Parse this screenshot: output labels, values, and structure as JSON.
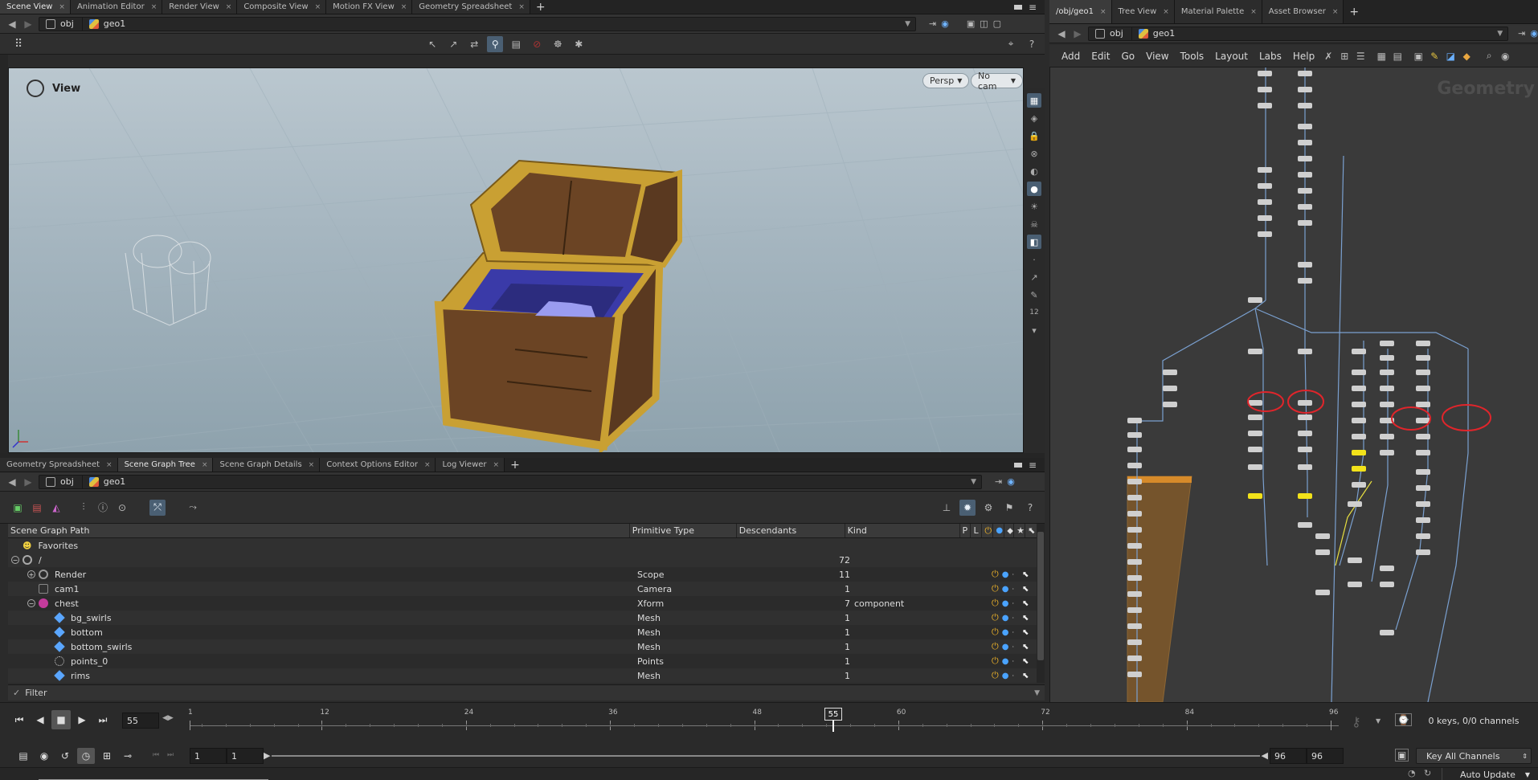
{
  "left_tabs": [
    {
      "label": "Scene View",
      "active": true
    },
    {
      "label": "Animation Editor"
    },
    {
      "label": "Render View"
    },
    {
      "label": "Composite View"
    },
    {
      "label": "Motion FX View"
    },
    {
      "label": "Geometry Spreadsheet"
    }
  ],
  "right_tabs": [
    {
      "label": "/obj/geo1",
      "active": true
    },
    {
      "label": "Tree View"
    },
    {
      "label": "Material Palette"
    },
    {
      "label": "Asset Browser"
    }
  ],
  "path": {
    "root": "obj",
    "node": "geo1"
  },
  "viewport": {
    "title": "View",
    "persp_label": "Persp",
    "cam_label": "No cam"
  },
  "bottom_tabs": [
    {
      "label": "Geometry Spreadsheet"
    },
    {
      "label": "Scene Graph Tree",
      "active": true
    },
    {
      "label": "Scene Graph Details"
    },
    {
      "label": "Context Options Editor"
    },
    {
      "label": "Log Viewer"
    }
  ],
  "scene_graph": {
    "columns": [
      "Scene Graph Path",
      "Primitive Type",
      "Descendants",
      "Kind",
      "P",
      "L"
    ],
    "favorites_label": "Favorites",
    "rows": [
      {
        "name": "/",
        "type": "",
        "desc": "72",
        "kind": "",
        "depth": 0,
        "icon": "root"
      },
      {
        "name": "Render",
        "type": "Scope",
        "desc": "11",
        "kind": "",
        "depth": 1,
        "icon": "scope"
      },
      {
        "name": "cam1",
        "type": "Camera",
        "desc": "1",
        "kind": "",
        "depth": 1,
        "icon": "camera"
      },
      {
        "name": "chest",
        "type": "Xform",
        "desc": "7",
        "kind": "component",
        "depth": 1,
        "icon": "xform"
      },
      {
        "name": "bg_swirls",
        "type": "Mesh",
        "desc": "1",
        "kind": "",
        "depth": 2,
        "icon": "mesh"
      },
      {
        "name": "bottom",
        "type": "Mesh",
        "desc": "1",
        "kind": "",
        "depth": 2,
        "icon": "mesh"
      },
      {
        "name": "bottom_swirls",
        "type": "Mesh",
        "desc": "1",
        "kind": "",
        "depth": 2,
        "icon": "mesh"
      },
      {
        "name": "points_0",
        "type": "Points",
        "desc": "1",
        "kind": "",
        "depth": 2,
        "icon": "points"
      },
      {
        "name": "rims",
        "type": "Mesh",
        "desc": "1",
        "kind": "",
        "depth": 2,
        "icon": "mesh"
      }
    ],
    "filter_label": "Filter"
  },
  "network_menu": [
    "Add",
    "Edit",
    "Go",
    "View",
    "Tools",
    "Layout",
    "Labs",
    "Help"
  ],
  "network_watermark": "Geometry",
  "timeline": {
    "current_frame": "55",
    "frame_marker": "55",
    "ticks": [
      "1",
      "12",
      "24",
      "36",
      "48",
      "60",
      "72",
      "84",
      "96"
    ],
    "start": "1",
    "range_start": "1",
    "range_end": "96",
    "end": "96",
    "keys_status": "0 keys, 0/0 channels",
    "key_mode": "Key All Channels",
    "update_mode": "Auto Update"
  },
  "colors": {
    "accent": "#4a5f73",
    "power": "#f0b429",
    "visibility": "#4aa3ff",
    "node_highlight": "#f2e21a",
    "annotation": "#e0252b"
  }
}
